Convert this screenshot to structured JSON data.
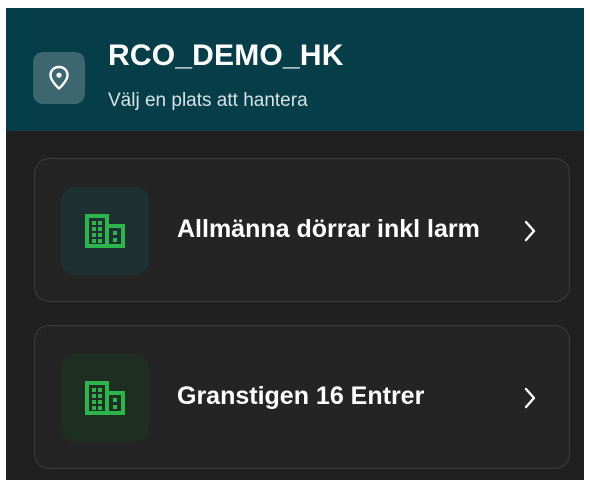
{
  "header": {
    "title": "RCO_DEMO_HK",
    "subtitle": "Välj en plats att hantera",
    "icon": "location-pin-icon"
  },
  "locations": [
    {
      "label": "Allmänna dörrar inkl larm",
      "icon": "building-icon",
      "chevron": "chevron-right-icon"
    },
    {
      "label": "Granstigen 16 Entrer",
      "icon": "building-icon",
      "chevron": "chevron-right-icon"
    }
  ],
  "colors": {
    "header_bg": "#053d49",
    "page_bg": "#202020",
    "accent_green": "#2bb54a",
    "icon_box_1": "#1d3133",
    "icon_box_2": "#1f2e22"
  }
}
